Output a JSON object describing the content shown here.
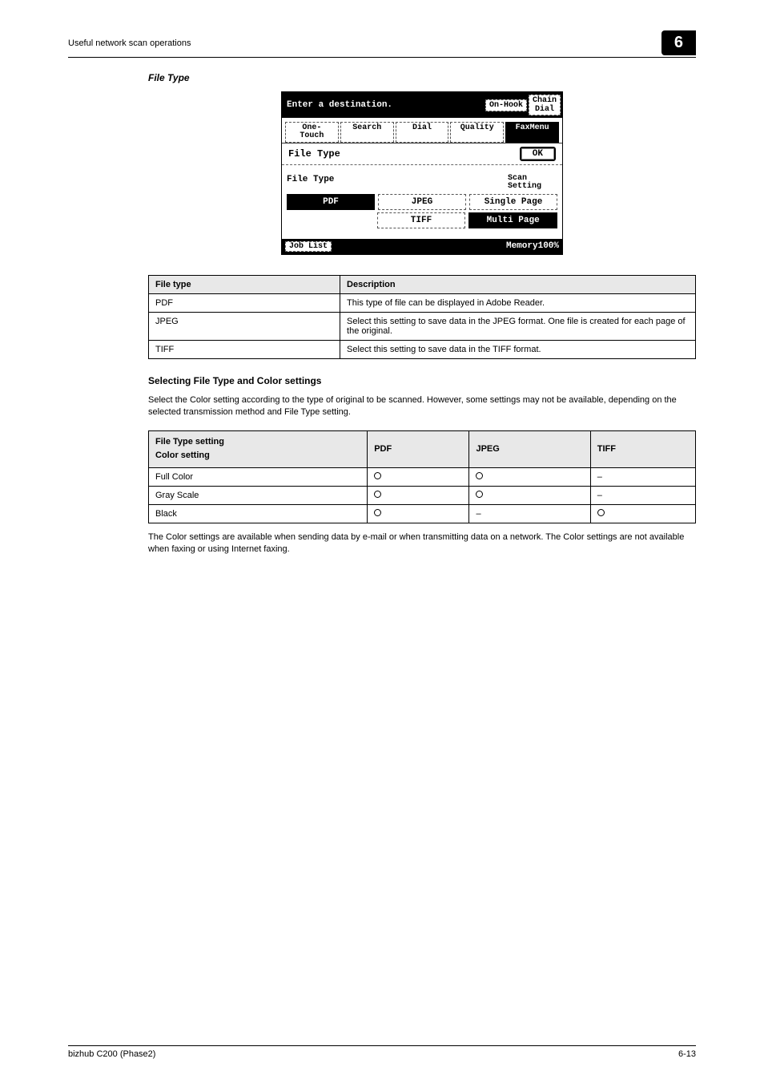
{
  "header": {
    "section_title": "Useful network scan operations",
    "chapter_number": "6"
  },
  "subheading": "File Type",
  "screenshot": {
    "topbar_text": "Enter a destination.",
    "btn_onhook": "On-Hook",
    "btn_chain": "Chain\nDial",
    "tabs": {
      "one_touch": "One-\nTouch",
      "search": "Search",
      "dial": "Dial",
      "quality": "Quality",
      "faxmenu": "FaxMenu"
    },
    "subhead_label": "File Type",
    "ok": "OK",
    "body_label_left": "File Type",
    "body_label_right": "Scan\nSetting",
    "btn_pdf": "PDF",
    "btn_jpeg": "JPEG",
    "btn_tiff": "TIFF",
    "btn_single": "Single Page",
    "btn_multi": "Multi Page",
    "footer_joblist": "Job List",
    "footer_memory": "Memory100%"
  },
  "desc_table": {
    "h1": "File type",
    "h2": "Description",
    "rows": [
      {
        "c1": "PDF",
        "c2": "This type of file can be displayed in Adobe Reader."
      },
      {
        "c1": "JPEG",
        "c2": "Select this setting to save data in the JPEG format. One file is created for each page of the original."
      },
      {
        "c1": "TIFF",
        "c2": "Select this setting to save data in the TIFF format."
      }
    ]
  },
  "section2": {
    "heading": "Selecting File Type and Color settings",
    "para": "Select the Color setting according to the type of original to be scanned. However, some settings may not be available, depending on the selected transmission method and File Type setting."
  },
  "color_table": {
    "h1a": "File Type setting",
    "h1b": "Color setting",
    "h2": "PDF",
    "h3": "JPEG",
    "h4": "TIFF",
    "rows": [
      {
        "label": "Full Color",
        "pdf": "o",
        "jpeg": "o",
        "tiff": "–"
      },
      {
        "label": "Gray Scale",
        "pdf": "o",
        "jpeg": "o",
        "tiff": "–"
      },
      {
        "label": "Black",
        "pdf": "o",
        "jpeg": "–",
        "tiff": "o"
      }
    ]
  },
  "para2": "The Color settings are available when sending data by e-mail or when transmitting data on a network. The Color settings are not available when faxing or using Internet faxing.",
  "footer": {
    "left": "bizhub C200 (Phase2)",
    "right": "6-13"
  }
}
